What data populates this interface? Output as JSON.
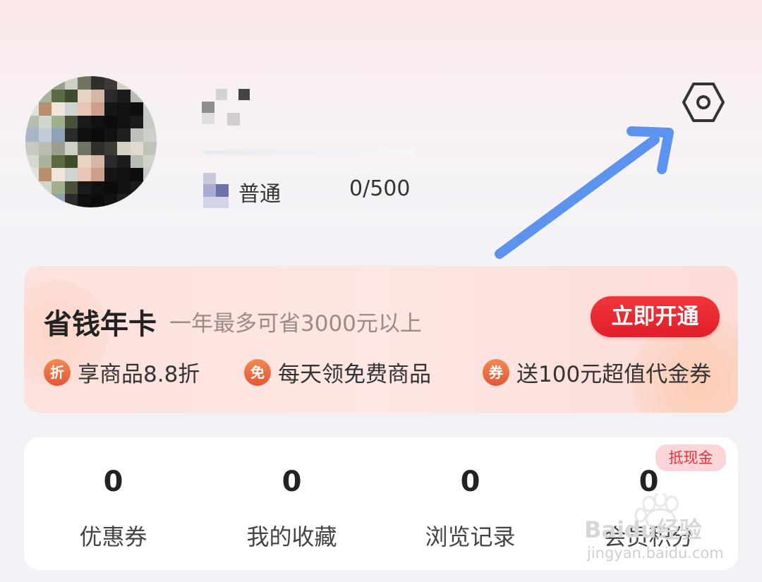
{
  "profile": {
    "level_label": "普通",
    "points": "0/500",
    "settings_icon": "hexagon-settings-icon"
  },
  "card": {
    "title": "省钱年卡",
    "subtitle": "一年最多可省3000元以上",
    "button": "立即开通",
    "perks": [
      {
        "icon_text": "折",
        "text": "享商品8.8折"
      },
      {
        "icon_text": "免",
        "text": "每天领免费商品"
      },
      {
        "icon_text": "券",
        "text": "送100元超值代金券"
      }
    ],
    "accent_color": "#e8232f"
  },
  "stats": {
    "items": [
      {
        "value": "0",
        "label": "优惠券"
      },
      {
        "value": "0",
        "label": "我的收藏"
      },
      {
        "value": "0",
        "label": "浏览记录"
      },
      {
        "value": "0",
        "label": "会员积分"
      }
    ],
    "badge": "抵现金"
  },
  "watermark": {
    "text": "Baidu经验",
    "url": "jingyan.baidu.com"
  }
}
